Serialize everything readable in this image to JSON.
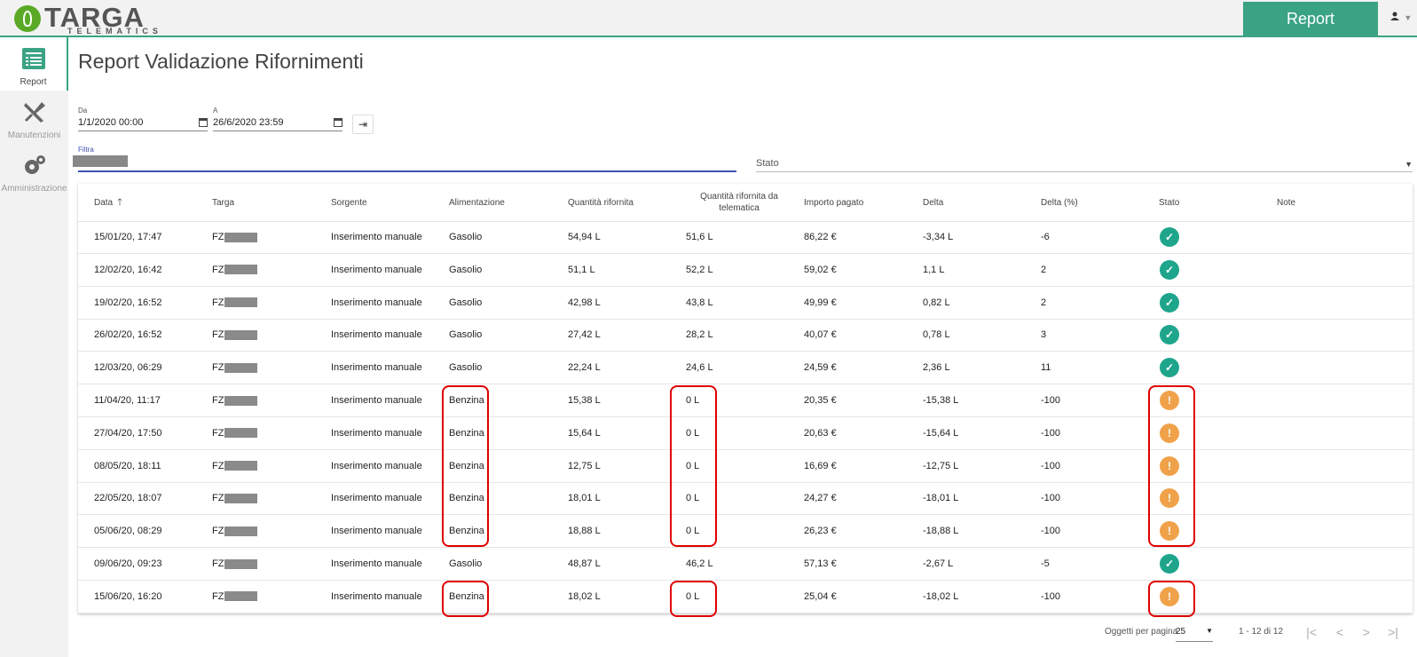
{
  "brand": {
    "name": "TARGA",
    "sub": "TELEMATICS"
  },
  "header": {
    "report_button": "Report",
    "user_icon": "user-icon"
  },
  "sidebar": {
    "items": [
      {
        "label": "Report",
        "icon": "report-icon",
        "active": true
      },
      {
        "label": "Manutenzioni",
        "icon": "wrench-icon",
        "active": false
      },
      {
        "label": "Amministrazione",
        "icon": "gear-icon",
        "active": false
      }
    ]
  },
  "page": {
    "title": "Report Validazione Rifornimenti"
  },
  "filters": {
    "from_label": "Da",
    "from_value": "1/1/2020 00:00",
    "to_label": "A",
    "to_value": "26/6/2020 23:59",
    "filter_label": "Filtra",
    "stato_placeholder": "Stato"
  },
  "table": {
    "headers": [
      "Data",
      "Targa",
      "Sorgente",
      "Alimentazione",
      "Quantità rifornita",
      "Quantità rifornita da telematica",
      "Importo pagato",
      "Delta",
      "Delta (%)",
      "Stato",
      "Note"
    ],
    "sort_icon": "arrow-up-icon",
    "rows": [
      {
        "data": "15/01/20, 17:47",
        "targa": "FZ",
        "sorgente": "Inserimento manuale",
        "alimentazione": "Gasolio",
        "quantita": "54,94 L",
        "telematica": "51,6 L",
        "importo": "86,22 €",
        "delta": "-3,34 L",
        "delta_pct": "-6",
        "stato": "ok"
      },
      {
        "data": "12/02/20, 16:42",
        "targa": "FZ",
        "sorgente": "Inserimento manuale",
        "alimentazione": "Gasolio",
        "quantita": "51,1 L",
        "telematica": "52,2 L",
        "importo": "59,02 €",
        "delta": "1,1 L",
        "delta_pct": "2",
        "stato": "ok"
      },
      {
        "data": "19/02/20, 16:52",
        "targa": "FZ",
        "sorgente": "Inserimento manuale",
        "alimentazione": "Gasolio",
        "quantita": "42,98 L",
        "telematica": "43,8 L",
        "importo": "49,99 €",
        "delta": "0,82 L",
        "delta_pct": "2",
        "stato": "ok"
      },
      {
        "data": "26/02/20, 16:52",
        "targa": "FZ",
        "sorgente": "Inserimento manuale",
        "alimentazione": "Gasolio",
        "quantita": "27,42 L",
        "telematica": "28,2 L",
        "importo": "40,07 €",
        "delta": "0,78 L",
        "delta_pct": "3",
        "stato": "ok"
      },
      {
        "data": "12/03/20, 06:29",
        "targa": "FZ",
        "sorgente": "Inserimento manuale",
        "alimentazione": "Gasolio",
        "quantita": "22,24 L",
        "telematica": "24,6 L",
        "importo": "24,59 €",
        "delta": "2,36 L",
        "delta_pct": "11",
        "stato": "ok"
      },
      {
        "data": "11/04/20, 11:17",
        "targa": "FZ",
        "sorgente": "Inserimento manuale",
        "alimentazione": "Benzina",
        "quantita": "15,38 L",
        "telematica": "0 L",
        "importo": "20,35 €",
        "delta": "-15,38 L",
        "delta_pct": "-100",
        "stato": "warn"
      },
      {
        "data": "27/04/20, 17:50",
        "targa": "FZ",
        "sorgente": "Inserimento manuale",
        "alimentazione": "Benzina",
        "quantita": "15,64 L",
        "telematica": "0 L",
        "importo": "20,63 €",
        "delta": "-15,64 L",
        "delta_pct": "-100",
        "stato": "warn"
      },
      {
        "data": "08/05/20, 18:11",
        "targa": "FZ",
        "sorgente": "Inserimento manuale",
        "alimentazione": "Benzina",
        "quantita": "12,75 L",
        "telematica": "0 L",
        "importo": "16,69 €",
        "delta": "-12,75 L",
        "delta_pct": "-100",
        "stato": "warn"
      },
      {
        "data": "22/05/20, 18:07",
        "targa": "FZ",
        "sorgente": "Inserimento manuale",
        "alimentazione": "Benzina",
        "quantita": "18,01 L",
        "telematica": "0 L",
        "importo": "24,27 €",
        "delta": "-18,01 L",
        "delta_pct": "-100",
        "stato": "warn"
      },
      {
        "data": "05/06/20, 08:29",
        "targa": "FZ",
        "sorgente": "Inserimento manuale",
        "alimentazione": "Benzina",
        "quantita": "18,88 L",
        "telematica": "0 L",
        "importo": "26,23 €",
        "delta": "-18,88 L",
        "delta_pct": "-100",
        "stato": "warn"
      },
      {
        "data": "09/06/20, 09:23",
        "targa": "FZ",
        "sorgente": "Inserimento manuale",
        "alimentazione": "Gasolio",
        "quantita": "48,87 L",
        "telematica": "46,2 L",
        "importo": "57,13 €",
        "delta": "-2,67 L",
        "delta_pct": "-5",
        "stato": "ok"
      },
      {
        "data": "15/06/20, 16:20",
        "targa": "FZ",
        "sorgente": "Inserimento manuale",
        "alimentazione": "Benzina",
        "quantita": "18,02 L",
        "telematica": "0 L",
        "importo": "25,04 €",
        "delta": "-18,02 L",
        "delta_pct": "-100",
        "stato": "warn"
      }
    ]
  },
  "pagination": {
    "per_page_label": "Oggetti per pagina",
    "per_page_value": "25",
    "range": "1 - 12 di 12"
  },
  "colors": {
    "accent": "#3aa383",
    "ok": "#1ea58c",
    "warn": "#f0a24a",
    "highlight": "#e00000",
    "filter_underline": "#3f51b5"
  }
}
